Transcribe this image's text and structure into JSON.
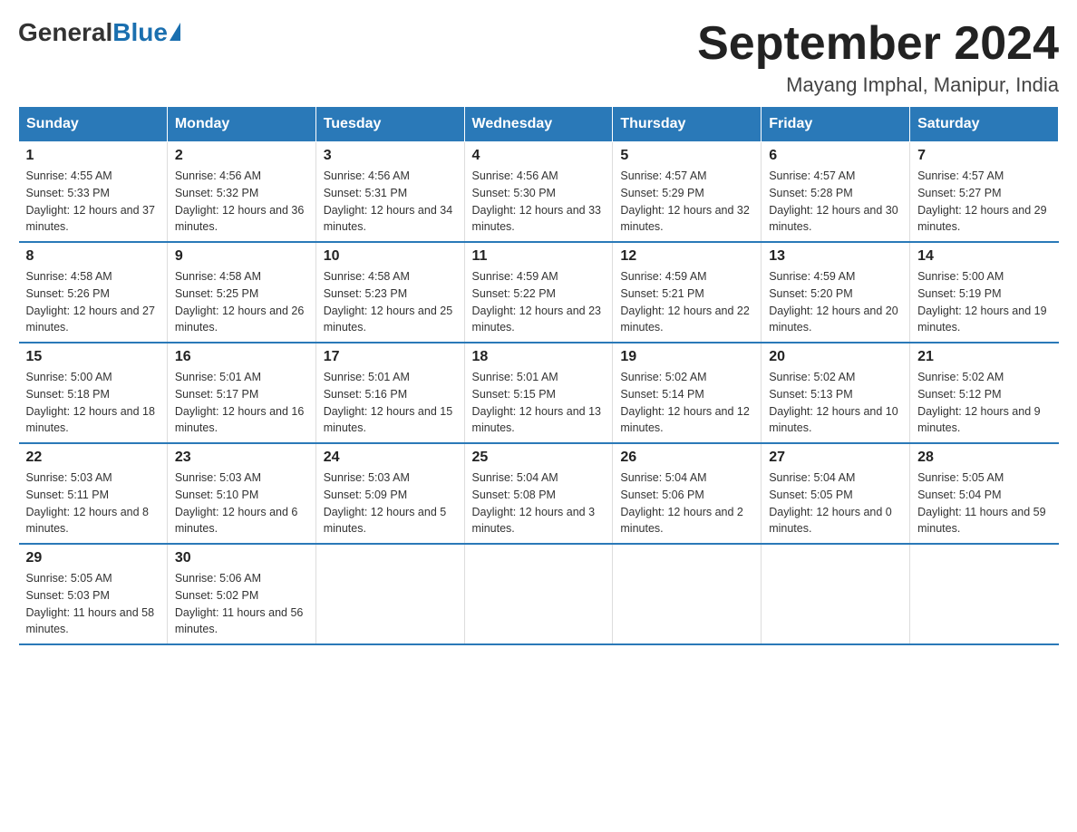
{
  "header": {
    "logo_general": "General",
    "logo_blue": "Blue",
    "month_title": "September 2024",
    "location": "Mayang Imphal, Manipur, India"
  },
  "weekdays": [
    "Sunday",
    "Monday",
    "Tuesday",
    "Wednesday",
    "Thursday",
    "Friday",
    "Saturday"
  ],
  "weeks": [
    [
      {
        "day": "1",
        "sunrise": "Sunrise: 4:55 AM",
        "sunset": "Sunset: 5:33 PM",
        "daylight": "Daylight: 12 hours and 37 minutes."
      },
      {
        "day": "2",
        "sunrise": "Sunrise: 4:56 AM",
        "sunset": "Sunset: 5:32 PM",
        "daylight": "Daylight: 12 hours and 36 minutes."
      },
      {
        "day": "3",
        "sunrise": "Sunrise: 4:56 AM",
        "sunset": "Sunset: 5:31 PM",
        "daylight": "Daylight: 12 hours and 34 minutes."
      },
      {
        "day": "4",
        "sunrise": "Sunrise: 4:56 AM",
        "sunset": "Sunset: 5:30 PM",
        "daylight": "Daylight: 12 hours and 33 minutes."
      },
      {
        "day": "5",
        "sunrise": "Sunrise: 4:57 AM",
        "sunset": "Sunset: 5:29 PM",
        "daylight": "Daylight: 12 hours and 32 minutes."
      },
      {
        "day": "6",
        "sunrise": "Sunrise: 4:57 AM",
        "sunset": "Sunset: 5:28 PM",
        "daylight": "Daylight: 12 hours and 30 minutes."
      },
      {
        "day": "7",
        "sunrise": "Sunrise: 4:57 AM",
        "sunset": "Sunset: 5:27 PM",
        "daylight": "Daylight: 12 hours and 29 minutes."
      }
    ],
    [
      {
        "day": "8",
        "sunrise": "Sunrise: 4:58 AM",
        "sunset": "Sunset: 5:26 PM",
        "daylight": "Daylight: 12 hours and 27 minutes."
      },
      {
        "day": "9",
        "sunrise": "Sunrise: 4:58 AM",
        "sunset": "Sunset: 5:25 PM",
        "daylight": "Daylight: 12 hours and 26 minutes."
      },
      {
        "day": "10",
        "sunrise": "Sunrise: 4:58 AM",
        "sunset": "Sunset: 5:23 PM",
        "daylight": "Daylight: 12 hours and 25 minutes."
      },
      {
        "day": "11",
        "sunrise": "Sunrise: 4:59 AM",
        "sunset": "Sunset: 5:22 PM",
        "daylight": "Daylight: 12 hours and 23 minutes."
      },
      {
        "day": "12",
        "sunrise": "Sunrise: 4:59 AM",
        "sunset": "Sunset: 5:21 PM",
        "daylight": "Daylight: 12 hours and 22 minutes."
      },
      {
        "day": "13",
        "sunrise": "Sunrise: 4:59 AM",
        "sunset": "Sunset: 5:20 PM",
        "daylight": "Daylight: 12 hours and 20 minutes."
      },
      {
        "day": "14",
        "sunrise": "Sunrise: 5:00 AM",
        "sunset": "Sunset: 5:19 PM",
        "daylight": "Daylight: 12 hours and 19 minutes."
      }
    ],
    [
      {
        "day": "15",
        "sunrise": "Sunrise: 5:00 AM",
        "sunset": "Sunset: 5:18 PM",
        "daylight": "Daylight: 12 hours and 18 minutes."
      },
      {
        "day": "16",
        "sunrise": "Sunrise: 5:01 AM",
        "sunset": "Sunset: 5:17 PM",
        "daylight": "Daylight: 12 hours and 16 minutes."
      },
      {
        "day": "17",
        "sunrise": "Sunrise: 5:01 AM",
        "sunset": "Sunset: 5:16 PM",
        "daylight": "Daylight: 12 hours and 15 minutes."
      },
      {
        "day": "18",
        "sunrise": "Sunrise: 5:01 AM",
        "sunset": "Sunset: 5:15 PM",
        "daylight": "Daylight: 12 hours and 13 minutes."
      },
      {
        "day": "19",
        "sunrise": "Sunrise: 5:02 AM",
        "sunset": "Sunset: 5:14 PM",
        "daylight": "Daylight: 12 hours and 12 minutes."
      },
      {
        "day": "20",
        "sunrise": "Sunrise: 5:02 AM",
        "sunset": "Sunset: 5:13 PM",
        "daylight": "Daylight: 12 hours and 10 minutes."
      },
      {
        "day": "21",
        "sunrise": "Sunrise: 5:02 AM",
        "sunset": "Sunset: 5:12 PM",
        "daylight": "Daylight: 12 hours and 9 minutes."
      }
    ],
    [
      {
        "day": "22",
        "sunrise": "Sunrise: 5:03 AM",
        "sunset": "Sunset: 5:11 PM",
        "daylight": "Daylight: 12 hours and 8 minutes."
      },
      {
        "day": "23",
        "sunrise": "Sunrise: 5:03 AM",
        "sunset": "Sunset: 5:10 PM",
        "daylight": "Daylight: 12 hours and 6 minutes."
      },
      {
        "day": "24",
        "sunrise": "Sunrise: 5:03 AM",
        "sunset": "Sunset: 5:09 PM",
        "daylight": "Daylight: 12 hours and 5 minutes."
      },
      {
        "day": "25",
        "sunrise": "Sunrise: 5:04 AM",
        "sunset": "Sunset: 5:08 PM",
        "daylight": "Daylight: 12 hours and 3 minutes."
      },
      {
        "day": "26",
        "sunrise": "Sunrise: 5:04 AM",
        "sunset": "Sunset: 5:06 PM",
        "daylight": "Daylight: 12 hours and 2 minutes."
      },
      {
        "day": "27",
        "sunrise": "Sunrise: 5:04 AM",
        "sunset": "Sunset: 5:05 PM",
        "daylight": "Daylight: 12 hours and 0 minutes."
      },
      {
        "day": "28",
        "sunrise": "Sunrise: 5:05 AM",
        "sunset": "Sunset: 5:04 PM",
        "daylight": "Daylight: 11 hours and 59 minutes."
      }
    ],
    [
      {
        "day": "29",
        "sunrise": "Sunrise: 5:05 AM",
        "sunset": "Sunset: 5:03 PM",
        "daylight": "Daylight: 11 hours and 58 minutes."
      },
      {
        "day": "30",
        "sunrise": "Sunrise: 5:06 AM",
        "sunset": "Sunset: 5:02 PM",
        "daylight": "Daylight: 11 hours and 56 minutes."
      },
      null,
      null,
      null,
      null,
      null
    ]
  ]
}
